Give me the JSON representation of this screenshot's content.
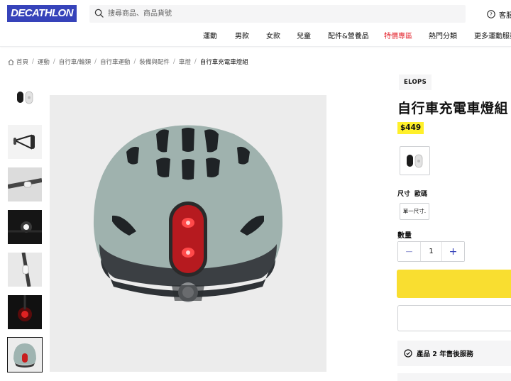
{
  "header": {
    "logo_text": "DECATHLON",
    "search_placeholder": "搜尋商品、商品貨號",
    "help_label": "客服",
    "brand_color": "#3643ba"
  },
  "nav": {
    "items": [
      "運動",
      "男款",
      "女款",
      "兒童",
      "配件&營養品",
      "特價專區",
      "熱門分類",
      "更多運動服務"
    ],
    "sale_color": "#e3262f"
  },
  "breadcrumb": {
    "items": [
      "首頁",
      "運動",
      "自行車/輪類",
      "自行車運動",
      "裝備與配件",
      "車燈"
    ],
    "current": "自行車充電車燈組"
  },
  "product": {
    "brand": "ELOPS",
    "title": "自行車充電車燈組",
    "price": "$449",
    "size_label": "尺寸",
    "size_guide": "歐碼",
    "size_option": "單一尺寸.",
    "qty_label": "數量",
    "qty_value": "1",
    "qty_minus": "−",
    "qty_plus": "+",
    "warranty": "產品 2 年售後服務",
    "price_highlight": "#fff02a",
    "cta_color": "#f9de30"
  },
  "icons": {
    "search": "search-icon",
    "help": "help-circle-icon",
    "home": "home-icon",
    "warranty": "warranty-badge-icon"
  }
}
